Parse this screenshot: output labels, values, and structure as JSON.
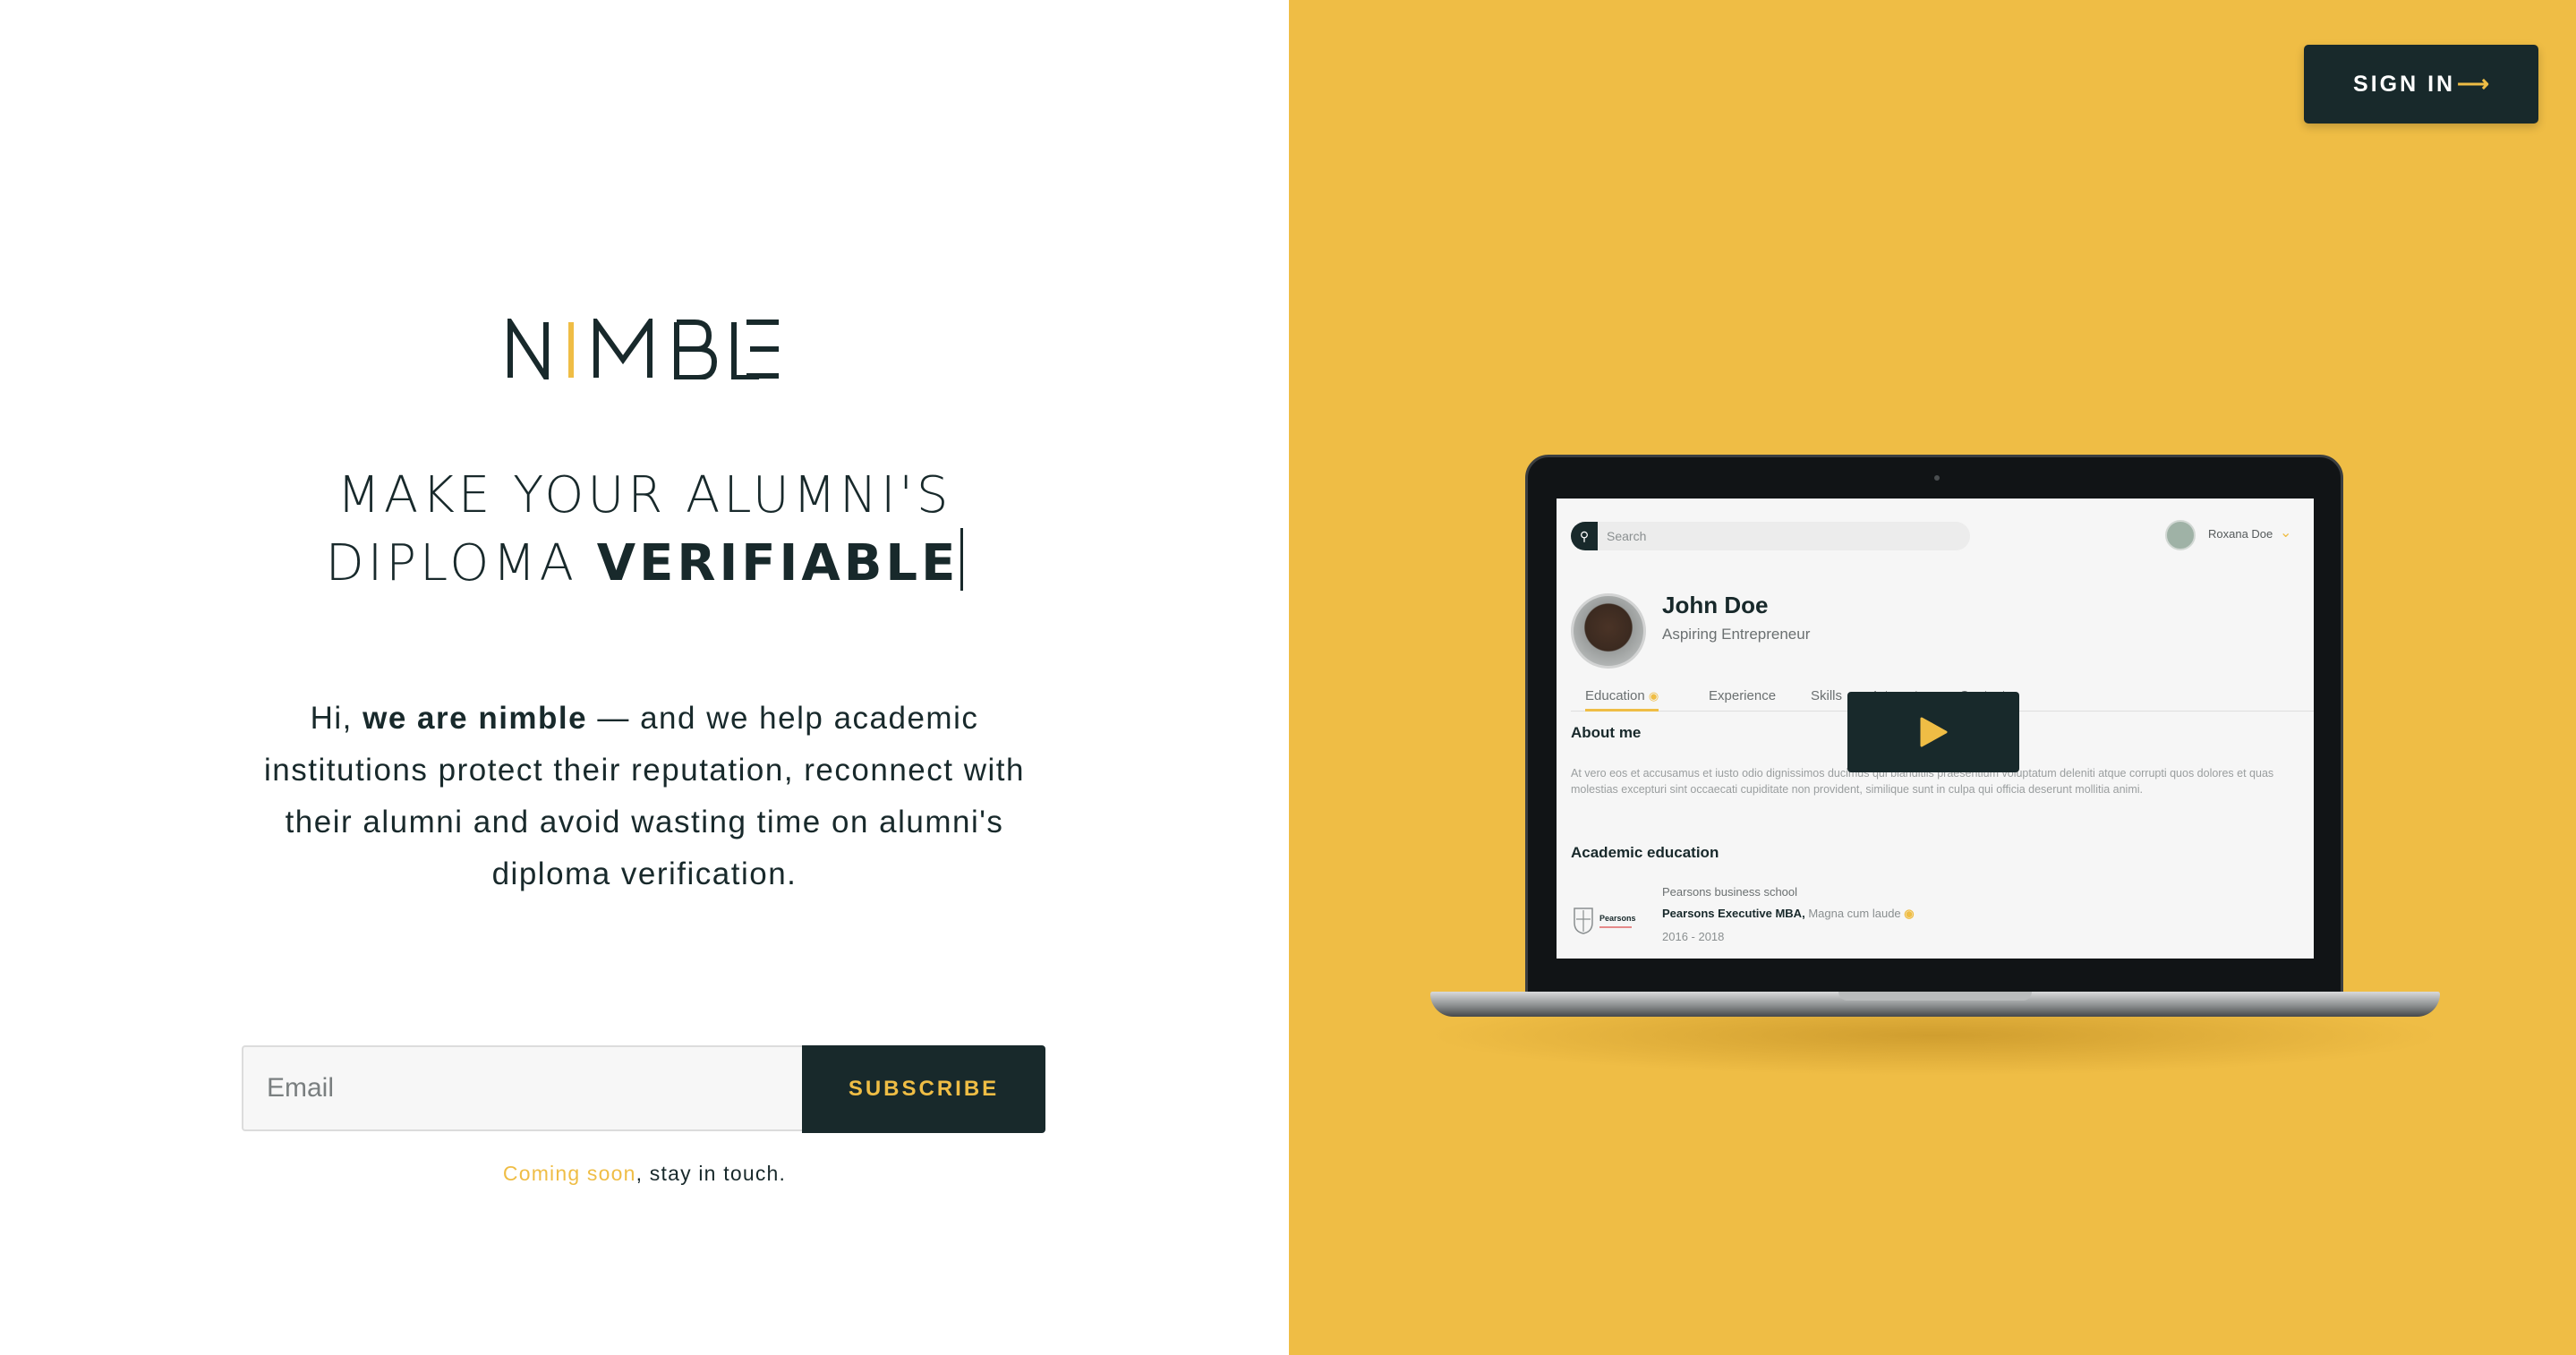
{
  "brand": {
    "logo_text": "NIMBLE"
  },
  "hero": {
    "headline_line1": "MAKE YOUR ALUMNI'S",
    "headline_line2_prefix": "DIPLOMA",
    "headline_line2_strong": "VERIFIABLE"
  },
  "intro": {
    "prefix": "Hi,",
    "strong": "we are nimble",
    "body": "— and we help academic institutions protect their reputation, reconnect with their alumni and avoid wasting time on alumni's diploma verification."
  },
  "subscribe": {
    "email_placeholder": "Email",
    "button_label": "SUBSCRIBE",
    "note_accent": "Coming soon",
    "note_rest": ", stay in touch."
  },
  "header": {
    "signin_label": "SIGN IN",
    "signin_arrow": "⟶"
  },
  "preview": {
    "search_placeholder": "Search",
    "user_name": "Roxana Doe",
    "profile_name": "John Doe",
    "profile_role": "Aspiring Entrepreneur",
    "tabs": [
      "Education",
      "Experience",
      "Skills",
      "Interests",
      "Contacts"
    ],
    "about_title": "About me",
    "about_text": "At vero eos et accusamus et iusto odio dignissimos ducimus qui blanditiis praesentium voluptatum deleniti atque corrupti quos dolores et quas molestias excepturi sint occaecati cupiditate non provident, similique sunt in culpa qui officia deserunt mollitia animi.",
    "education_title": "Academic education",
    "school": "Pearsons business school",
    "degree": "Pearsons Executive MBA,",
    "honor": "Magna cum laude",
    "years": "2016 - 2018",
    "school_logo_text": "Pearsons"
  },
  "colors": {
    "accent": "#efbd45",
    "dark": "#18292b",
    "white": "#ffffff"
  },
  "icons": {
    "play": "play-icon",
    "search": "search-icon",
    "chevron": "chevron-down-icon",
    "check": "check-circle-icon"
  }
}
